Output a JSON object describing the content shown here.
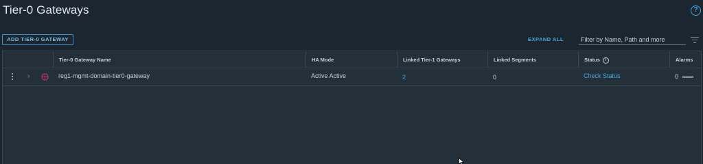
{
  "header": {
    "title": "Tier-0 Gateways",
    "help_glyph": "?"
  },
  "toolbar": {
    "add_label": "ADD TIER-0 GATEWAY",
    "expand_all_label": "EXPAND ALL",
    "filter_placeholder": "Filter by Name, Path and more"
  },
  "table": {
    "columns": {
      "name": "Tier-0 Gateway Name",
      "ha_mode": "HA Mode",
      "linked_tier1": "Linked Tier-1 Gateways",
      "linked_segments": "Linked Segments",
      "status": "Status",
      "alarms": "Alarms"
    },
    "status_info_glyph": "i",
    "expand_glyph": "›",
    "rows": [
      {
        "name": "reg1-mgmt-domain-tier0-gateway",
        "ha_mode": "Active Active",
        "linked_tier1": "2",
        "linked_segments": "0",
        "status": "Check Status",
        "alarms": "0"
      }
    ]
  },
  "colors": {
    "background": "#1c2630",
    "accent": "#4da6e0",
    "gateway_icon": "#c2386b"
  },
  "icons": {
    "help": "help-circle-icon",
    "filter": "filter-lines-icon",
    "row_menu": "kebab-menu-icon",
    "expand": "chevron-right-icon",
    "gateway": "globe-icon",
    "status_info": "info-icon",
    "cursor": "mouse-pointer-icon"
  }
}
